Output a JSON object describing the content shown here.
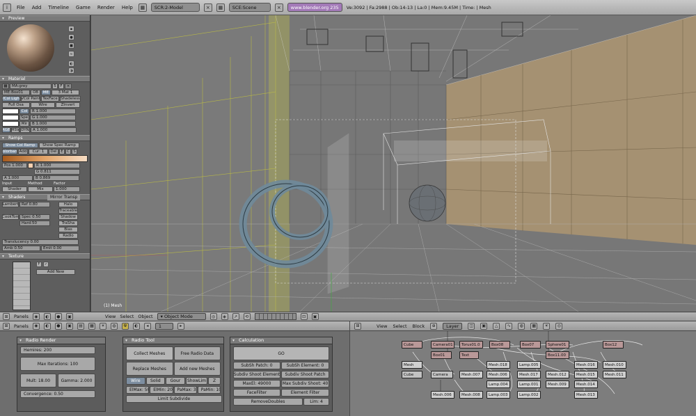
{
  "topbar": {
    "menus": [
      "File",
      "Add",
      "Timeline",
      "Game",
      "Render",
      "Help"
    ],
    "screen": "SCR:2-Model",
    "scene": "SCE:Scene",
    "url": "www.blender.org 235",
    "stats": "Ve:3092 | Fa:2988 | Ob:14-13 | La:0 | Mem:9.45M | Time: | Mesh"
  },
  "left": {
    "preview_title": "Preview",
    "material_title": "Material",
    "material_name": "MA:grey",
    "material_users": "5",
    "material_f": "F",
    "me_name": "ME:Box01",
    "ob_label": "OB",
    "me_label": "ME",
    "mat_count": "3 Mat 1",
    "toggles1": [
      "VCol Light",
      "VCol Paint",
      "TexFace",
      "Shadeless"
    ],
    "toggles2": [
      "Full Osa",
      "Wire",
      "ZInvert"
    ],
    "color_labels": [
      "Col",
      "Spe",
      "Mir"
    ],
    "rgb_values": [
      "R 1.000",
      "G 1.000",
      "B 1.000"
    ],
    "color_modes": [
      "RGB",
      "HSV",
      "DYN"
    ],
    "alpha": "A 1.000",
    "ramps_title": "Ramps",
    "ramp_buttons": [
      "Show Col Ramp",
      "Show Spec Ramp"
    ],
    "ramp_row": [
      "Colorband",
      "Add",
      "Cur: 1",
      "Del",
      "E",
      "C",
      "S"
    ],
    "pos": "Pos 1.000",
    "ramp_rgb": [
      "R 1.000",
      "G 0.811",
      "B 0.869"
    ],
    "ramp_alpha": "A 1.000",
    "ramp_input_labels": [
      "Input",
      "Method",
      "Factor"
    ],
    "ramp_input_vals": [
      "Shader",
      "Mix",
      "1.000"
    ],
    "shaders_title": "Shaders",
    "mirror_tab": "Mirror Transp",
    "lambert": "Lambert",
    "ref": "Ref 0.80",
    "halo": "Halo",
    "traceable": "Traceable",
    "cooktorr": "CookTorr",
    "spec": "Spec 0.50",
    "hard": "Hard:50",
    "shadow": "Shadow",
    "trasha": "TraSha",
    "bias": "Bias",
    "radio": "Radio",
    "translucency": "Translucency 0.00",
    "amb": "Amb 0.50",
    "emit": "Emit 0.00",
    "texture_title": "Texture",
    "add_new": "Add New"
  },
  "viewport": {
    "label": "(1) Mesh",
    "menus": [
      "View",
      "Select",
      "Object"
    ],
    "mode": "Object Mode",
    "panels": "Panels"
  },
  "bottom": {
    "panels": "Panels",
    "page": "1",
    "radio_render": {
      "title": "Radio Render",
      "hemires": "Hemires: 200",
      "max_iter": "Max Iterations: 100",
      "mult": "Mult: 18.00",
      "gamma": "Gamma: 2.000",
      "convergence": "Convergence: 0.50"
    },
    "radio_tool": {
      "title": "Radio Tool",
      "collect": "Collect Meshes",
      "free": "Free Radio Data",
      "replace": "Replace Meshes",
      "add_new": "Add new Meshes",
      "draw_modes": [
        "Wire",
        "Solid",
        "Gour",
        "ShowLim",
        "Z"
      ],
      "elmax": "ElMax: 50",
      "elmin": "ElMin: 20",
      "pamax": "PaMax: 312",
      "pamin": "PaMin: 108",
      "limit": "Limit Subdivide"
    },
    "calculation": {
      "title": "Calculation",
      "go": "GO",
      "subsh_patch": "SubSh Patch: 0",
      "subsh_element": "SubSh Element: 0",
      "subdiv_shoot_element": "Subdiv Shoot Element",
      "subdiv_shoot_patch": "Subdiv Shoot Patch",
      "maxel": "MaxEl: 49000",
      "max_subdiv": "Max Subdiv Shoot: 40",
      "facefilter": "FaceFilter",
      "element_filter": "Element Filter",
      "remove_doubles": "RemoveDoubles",
      "lim": "Lim: 4"
    }
  },
  "oops": {
    "menus": [
      "View",
      "Select",
      "Block"
    ],
    "layer": "Layer",
    "nodes": [
      {
        "label": "Cube",
        "type": "sc"
      },
      {
        "label": "Camera01",
        "type": "sc"
      },
      {
        "label": "Torus01.0",
        "type": "sc"
      },
      {
        "label": "Box08",
        "type": "sc"
      },
      {
        "label": "Box07",
        "type": "sc"
      },
      {
        "label": "Sphere01",
        "type": "sc"
      },
      {
        "label": "Box12",
        "type": "sc"
      },
      {
        "label": "Box01",
        "type": "sc"
      },
      {
        "label": "Text",
        "type": "sc"
      },
      {
        "label": "Box11.00",
        "type": "sc"
      },
      {
        "label": "Mesh",
        "type": "me"
      },
      {
        "label": "Mesh.018",
        "type": "me"
      },
      {
        "label": "Lamp.005",
        "type": "me"
      },
      {
        "label": "Mesh.016",
        "type": "me"
      },
      {
        "label": "Mesh.010",
        "type": "me"
      },
      {
        "label": "Cube",
        "type": "me"
      },
      {
        "label": "Camera",
        "type": "me"
      },
      {
        "label": "Mesh.007",
        "type": "me"
      },
      {
        "label": "Mesh.006",
        "type": "me"
      },
      {
        "label": "Mesh.017",
        "type": "me"
      },
      {
        "label": "Mesh.012",
        "type": "me"
      },
      {
        "label": "Mesh.015",
        "type": "me"
      },
      {
        "label": "Mesh.011",
        "type": "me"
      },
      {
        "label": "Lamp.004",
        "type": "me"
      },
      {
        "label": "Lamp.001",
        "type": "me"
      },
      {
        "label": "Mesh.009",
        "type": "me"
      },
      {
        "label": "Mesh.014",
        "type": "me"
      },
      {
        "label": "Mesh.006",
        "type": "me"
      },
      {
        "label": "Mesh.008",
        "type": "me"
      },
      {
        "label": "Lamp.003",
        "type": "me"
      },
      {
        "label": "Lamp.002",
        "type": "me"
      },
      {
        "label": "Mesh.013",
        "type": "me"
      }
    ]
  }
}
